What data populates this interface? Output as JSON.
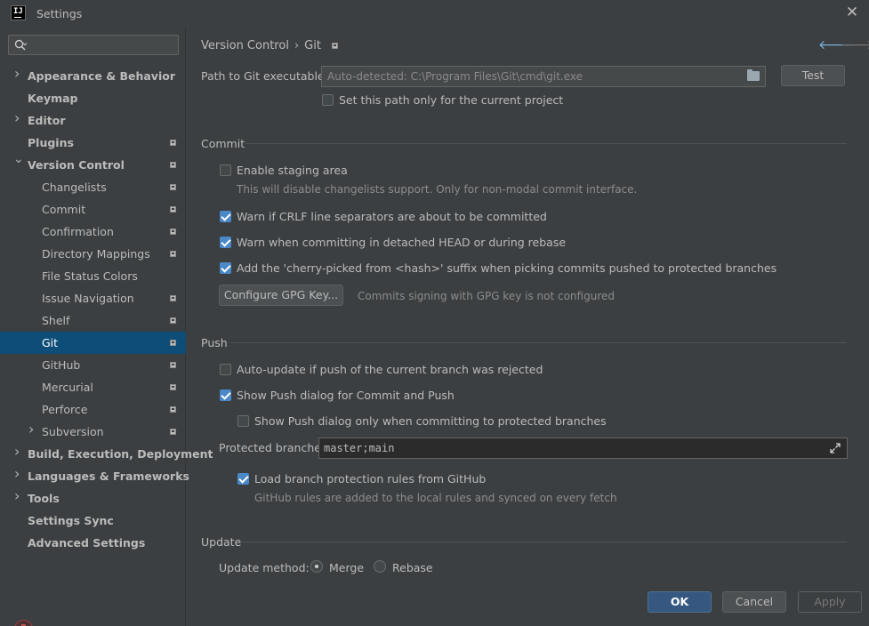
{
  "window": {
    "title": "Settings",
    "logo": "IJ"
  },
  "search": {
    "placeholder": ""
  },
  "sidebar": {
    "items": [
      {
        "label": "Appearance & Behavior",
        "arrow": "right",
        "bold": true,
        "project": false
      },
      {
        "label": "Keymap",
        "arrow": "",
        "bold": true,
        "project": false
      },
      {
        "label": "Editor",
        "arrow": "right",
        "bold": true,
        "project": false
      },
      {
        "label": "Plugins",
        "arrow": "",
        "bold": true,
        "project": true
      },
      {
        "label": "Version Control",
        "arrow": "down",
        "bold": true,
        "project": true
      },
      {
        "label": "Changelists",
        "arrow": "",
        "bold": false,
        "project": true
      },
      {
        "label": "Commit",
        "arrow": "",
        "bold": false,
        "project": true
      },
      {
        "label": "Confirmation",
        "arrow": "",
        "bold": false,
        "project": true
      },
      {
        "label": "Directory Mappings",
        "arrow": "",
        "bold": false,
        "project": true
      },
      {
        "label": "File Status Colors",
        "arrow": "",
        "bold": false,
        "project": false
      },
      {
        "label": "Issue Navigation",
        "arrow": "",
        "bold": false,
        "project": true
      },
      {
        "label": "Shelf",
        "arrow": "",
        "bold": false,
        "project": true
      },
      {
        "label": "Git",
        "arrow": "",
        "bold": false,
        "project": true,
        "selected": true
      },
      {
        "label": "GitHub",
        "arrow": "",
        "bold": false,
        "project": true
      },
      {
        "label": "Mercurial",
        "arrow": "",
        "bold": false,
        "project": true
      },
      {
        "label": "Perforce",
        "arrow": "",
        "bold": false,
        "project": true
      },
      {
        "label": "Subversion",
        "arrow": "right",
        "bold": false,
        "project": true
      },
      {
        "label": "Build, Execution, Deployment",
        "arrow": "right",
        "bold": true,
        "project": false
      },
      {
        "label": "Languages & Frameworks",
        "arrow": "right",
        "bold": true,
        "project": false
      },
      {
        "label": "Tools",
        "arrow": "right",
        "bold": true,
        "project": false
      },
      {
        "label": "Settings Sync",
        "arrow": "",
        "bold": true,
        "project": false
      },
      {
        "label": "Advanced Settings",
        "arrow": "",
        "bold": true,
        "project": false
      }
    ]
  },
  "breadcrumb": {
    "parent": "Version Control",
    "separator": "›",
    "current": "Git"
  },
  "git_path": {
    "label": "Path to Git executable:",
    "placeholder": "Auto-detected: C:\\Program Files\\Git\\cmd\\git.exe",
    "test_label": "Test",
    "project_only": {
      "label": "Set this path only for the current project",
      "checked": false
    }
  },
  "commit": {
    "title": "Commit",
    "staging": {
      "label": "Enable staging area",
      "checked": false,
      "hint": "This will disable changelists support. Only for non-modal commit interface."
    },
    "crlf": {
      "label": "Warn if CRLF line separators are about to be committed",
      "checked": true
    },
    "detached": {
      "label": "Warn when committing in detached HEAD or during rebase",
      "checked": true
    },
    "cherry": {
      "label": "Add the 'cherry-picked from <hash>' suffix when picking commits pushed to protected branches",
      "checked": true
    },
    "gpg_button": "Configure GPG Key...",
    "gpg_status": "Commits signing with GPG key is not configured"
  },
  "push": {
    "title": "Push",
    "auto_update": {
      "label": "Auto-update if push of the current branch was rejected",
      "checked": false
    },
    "show_dialog": {
      "label": "Show Push dialog for Commit and Push",
      "checked": true
    },
    "protected_only": {
      "label": "Show Push dialog only when committing to protected branches",
      "checked": false
    },
    "protected_label": "Protected branches:",
    "protected_value": "master;main",
    "load_rules": {
      "label": "Load branch protection rules from GitHub",
      "checked": true
    },
    "rules_hint": "GitHub rules are added to the local rules and synced on every fetch"
  },
  "update": {
    "title": "Update",
    "method_label": "Update method:",
    "options": [
      {
        "label": "Merge",
        "checked": true
      },
      {
        "label": "Rebase",
        "checked": false
      }
    ]
  },
  "footer": {
    "ok": "OK",
    "cancel": "Cancel",
    "apply": "Apply",
    "help": "?"
  },
  "colors": {
    "background": "#3c3f41",
    "selection": "#0d4d78",
    "accent": "#4a88c7",
    "primary_button": "#365880"
  }
}
